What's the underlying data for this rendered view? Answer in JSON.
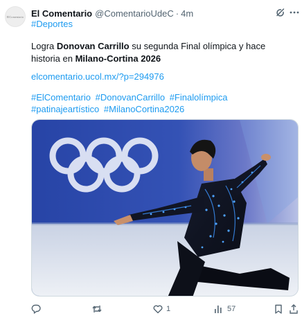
{
  "post": {
    "author_name": "El Comentario",
    "author_handle": "@ComentarioUdeC",
    "separator": "·",
    "timestamp": "4m",
    "avatar_text": "ElComentario",
    "category_tag": "#Deportes",
    "text_pre": "Logra ",
    "text_bold_name": "Donovan Carrillo",
    "text_mid": " su segunda Final olímpica y hace historia en ",
    "text_bold_event": "Milano-Cortina 2026",
    "link": "elcomentario.ucol.mx/?p=294976",
    "hashtags": [
      "#ElComentario",
      "#DonovanCarrillo",
      "#Finalolímpica",
      "#patinajeartístico",
      "#MilanoCortina2026"
    ],
    "image_description_icon": "photo"
  },
  "actions": {
    "reply_count": "",
    "repost_count": "",
    "like_count": "1",
    "views_count": "57"
  },
  "icons": {
    "grok": "grok-icon",
    "more": "more-icon",
    "reply": "reply-icon",
    "repost": "repost-icon",
    "like": "heart-icon",
    "views": "views-icon",
    "bookmark": "bookmark-icon",
    "share": "share-icon"
  },
  "colors": {
    "accent": "#1d9bf0",
    "text": "#0f1419",
    "muted": "#536471",
    "photo_backdrop": "#2a46a8"
  }
}
